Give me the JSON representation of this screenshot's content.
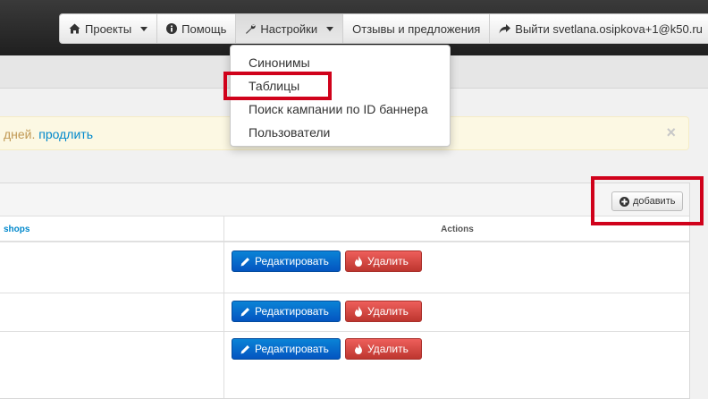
{
  "nav": {
    "projects": "Проекты",
    "help": "Помощь",
    "settings": "Настройки",
    "feedback": "Отзывы и предложения",
    "logout": "Выйти svetlana.osipkova+1@k50.ru"
  },
  "settings_menu": {
    "items": [
      "Синонимы",
      "Таблицы",
      "Поиск кампании по ID баннера",
      "Пользователи"
    ],
    "highlighted_item": "Таблицы"
  },
  "alert": {
    "text": "дней. ",
    "link": "продлить",
    "close": "×"
  },
  "panel": {
    "add_button": "добавить"
  },
  "table": {
    "columns": [
      "shops",
      "Actions"
    ],
    "rows": [
      {
        "edit": "Редактировать",
        "delete": "Удалить"
      },
      {
        "edit": "Редактировать",
        "delete": "Удалить"
      },
      {
        "edit": "Редактировать",
        "delete": "Удалить"
      }
    ]
  },
  "colors": {
    "accent": "#0088cc",
    "edit_button": "#0455c1",
    "delete_button": "#bd362f",
    "highlight": "#d0021b",
    "alert_bg": "#fcf8e3"
  },
  "icons": {
    "projects": "home-icon",
    "help": "info-icon",
    "settings": "wrench-icon",
    "logout": "share-arrow-icon",
    "add": "plus-circle-icon",
    "edit": "pencil-icon",
    "delete": "fire-icon"
  }
}
